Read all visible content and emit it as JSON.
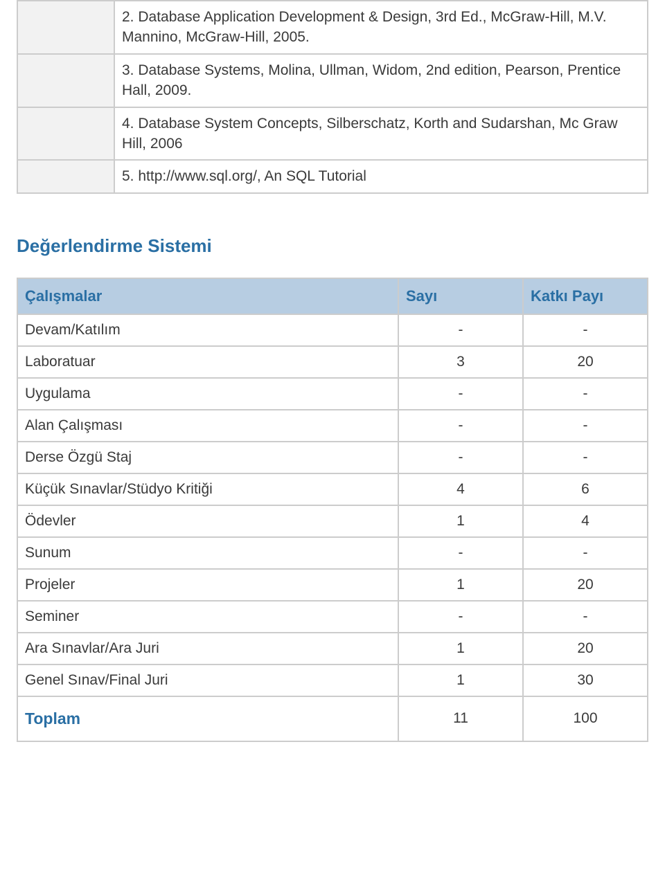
{
  "references": [
    "2. Database Application Development & Design, 3rd Ed., McGraw-Hill, M.V. Mannino, McGraw-Hill, 2005.",
    "3. Database Systems, Molina, Ullman, Widom, 2nd edition, Pearson, Prentice Hall, 2009.",
    "4. Database System Concepts, Silberschatz, Korth and Sudarshan, Mc Graw Hill, 2006",
    "5. http://www.sql.org/, An SQL Tutorial"
  ],
  "section_title": "Değerlendirme Sistemi",
  "eval": {
    "headers": [
      "Çalışmalar",
      "Sayı",
      "Katkı Payı"
    ],
    "rows": [
      {
        "label": "Devam/Katılım",
        "count": "-",
        "weight": "-"
      },
      {
        "label": "Laboratuar",
        "count": "3",
        "weight": "20"
      },
      {
        "label": "Uygulama",
        "count": "-",
        "weight": "-"
      },
      {
        "label": "Alan Çalışması",
        "count": "-",
        "weight": "-"
      },
      {
        "label": "Derse Özgü Staj",
        "count": "-",
        "weight": "-"
      },
      {
        "label": "Küçük Sınavlar/Stüdyo Kritiği",
        "count": "4",
        "weight": "6"
      },
      {
        "label": "Ödevler",
        "count": "1",
        "weight": "4"
      },
      {
        "label": "Sunum",
        "count": "-",
        "weight": "-"
      },
      {
        "label": "Projeler",
        "count": "1",
        "weight": "20"
      },
      {
        "label": "Seminer",
        "count": "-",
        "weight": "-"
      },
      {
        "label": "Ara Sınavlar/Ara Juri",
        "count": "1",
        "weight": "20"
      },
      {
        "label": "Genel Sınav/Final Juri",
        "count": "1",
        "weight": "30"
      }
    ],
    "total": {
      "label": "Toplam",
      "count": "11",
      "weight": "100"
    }
  }
}
